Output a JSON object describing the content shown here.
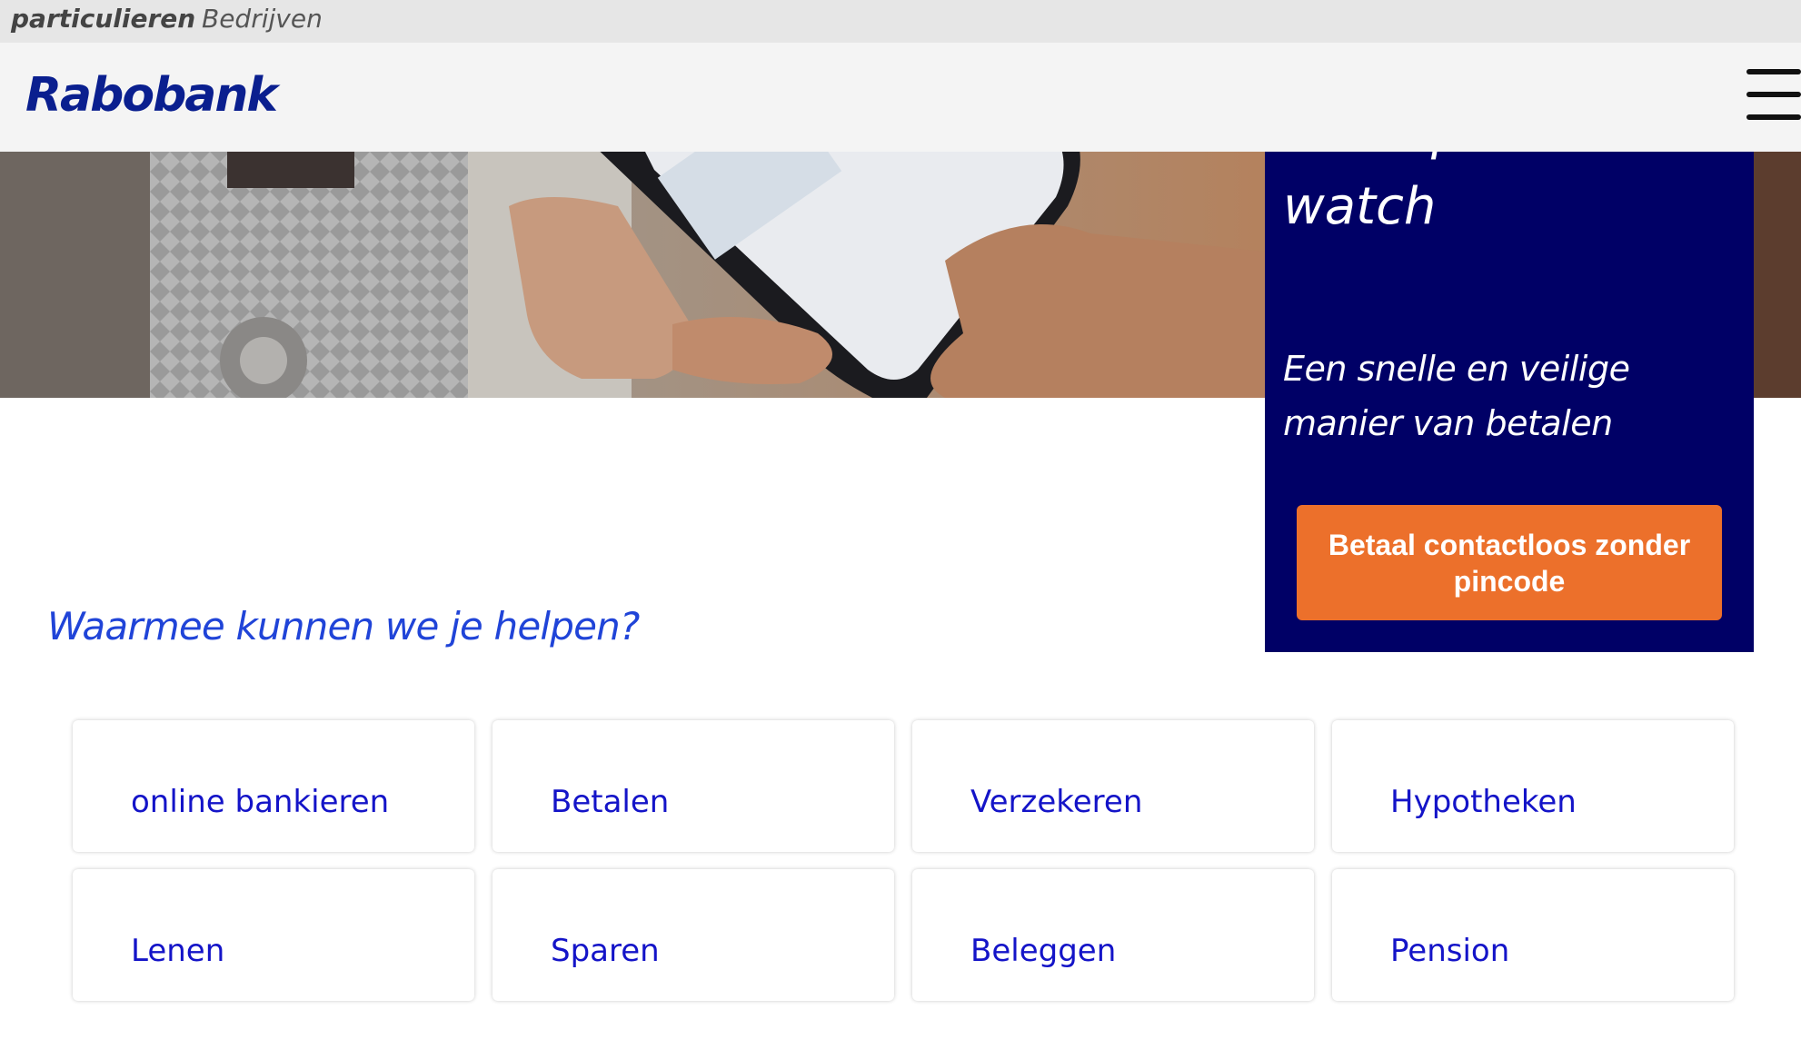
{
  "segments": {
    "particulieren": "particulieren",
    "bedrijven": "Bedrijven"
  },
  "header": {
    "logo": "Rabobank"
  },
  "promo": {
    "title_line1": "smartphone of -",
    "title_line2": "watch",
    "subtitle": "Een snelle en veilige manier van betalen",
    "cta": "Betaal contactloos zonder pincode"
  },
  "help": {
    "title": "Waarmee kunnen we je helpen?",
    "tiles": [
      {
        "label": "online bankieren"
      },
      {
        "label": "Betalen"
      },
      {
        "label": "Verzekeren"
      },
      {
        "label": "Hypotheken"
      },
      {
        "label": "Lenen"
      },
      {
        "label": "Sparen"
      },
      {
        "label": "Beleggen"
      },
      {
        "label": "Pension"
      }
    ]
  },
  "colors": {
    "brand_blue": "#000066",
    "cta_orange": "#ec702b",
    "link_blue": "#1414c8"
  }
}
